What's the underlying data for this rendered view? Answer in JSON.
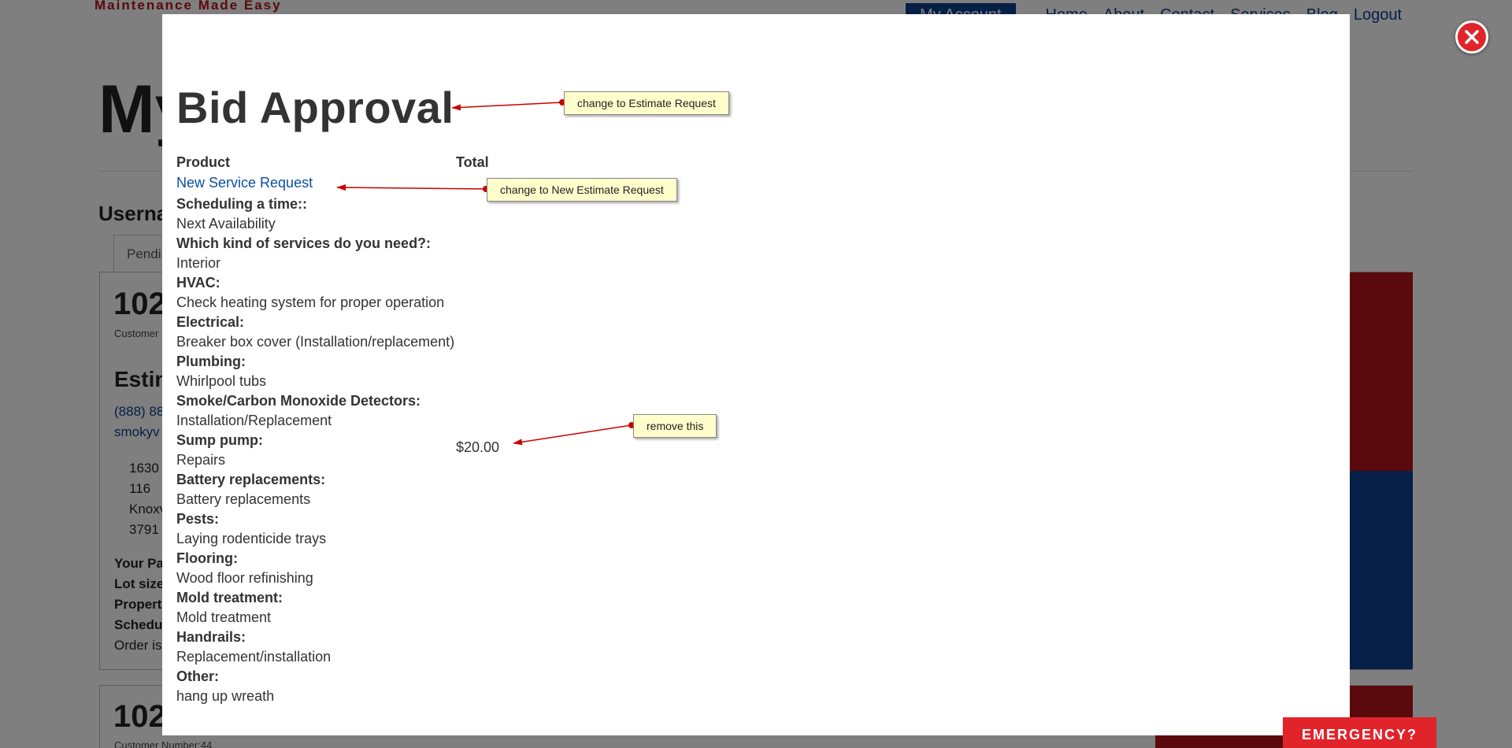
{
  "background": {
    "tagline": "Maintenance Made Easy",
    "nav": {
      "my_account": "My Account",
      "links": [
        "Home",
        "About",
        "Contact",
        "Services",
        "Blog",
        "Logout"
      ]
    },
    "page_title": "My",
    "username_label": "Userna",
    "tab_label": "Pendi",
    "order1": {
      "number": "102",
      "customer": "Customer",
      "estimate_heading": "Estin",
      "phone": "(888) 88",
      "email": "smokyv",
      "address": [
        "1630",
        "116",
        "Knoxv",
        "3791"
      ],
      "meta_labels": [
        "Your Pa",
        "Lot size",
        "Propert",
        "Schedu"
      ],
      "status": "Order is"
    },
    "order2": {
      "number": "102",
      "customer": "Customer Number:44"
    }
  },
  "modal": {
    "title": "Bid Approval",
    "columns": {
      "product": "Product",
      "total": "Total"
    },
    "product_link": "New Service Request",
    "details": [
      {
        "label": "Scheduling a time::",
        "value": "Next Availability"
      },
      {
        "label": "Which kind of services do you need?:",
        "value": "Interior"
      },
      {
        "label": "HVAC:",
        "value": "Check heating system for proper operation"
      },
      {
        "label": "Electrical:",
        "value": "Breaker box cover (Installation/replacement)"
      },
      {
        "label": "Plumbing:",
        "value": "Whirlpool tubs"
      },
      {
        "label": "Smoke/Carbon Monoxide Detectors:",
        "value": "Installation/Replacement"
      },
      {
        "label": "Sump pump:",
        "value": "Repairs"
      },
      {
        "label": "Battery replacements:",
        "value": "Battery replacements"
      },
      {
        "label": "Pests:",
        "value": "Laying rodenticide trays"
      },
      {
        "label": "Flooring:",
        "value": "Wood floor refinishing"
      },
      {
        "label": "Mold treatment:",
        "value": "Mold treatment"
      },
      {
        "label": "Handrails:",
        "value": "Replacement/installation"
      },
      {
        "label": "Other:",
        "value": "hang up wreath"
      }
    ],
    "price": "$20.00"
  },
  "annotations": {
    "title_note": "change to Estimate Request",
    "link_note": "change to New Estimate Request",
    "price_note": "remove this"
  },
  "emergency_label": "EMERGENCY?",
  "colors": {
    "brand_red": "#e1232a",
    "brand_blue": "#0a3f8c",
    "note_bg": "#ffffcc",
    "arrow": "#cc0000"
  }
}
